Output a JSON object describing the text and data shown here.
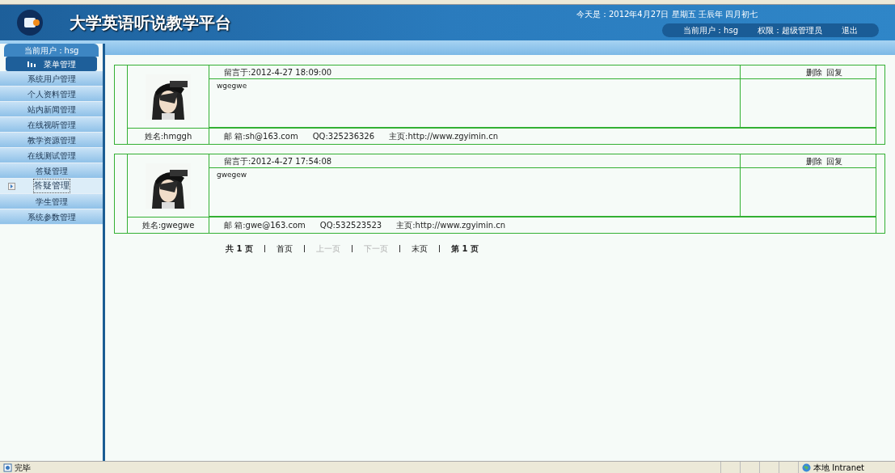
{
  "header": {
    "title": "大学英语听说教学平台",
    "date": "今天是：2012年4月27日 星期五 壬辰年 四月初七",
    "user": "当前用户：hsg",
    "role": "权限：超级管理员",
    "logout": "退出"
  },
  "sidebar": {
    "user": "当前用户：hsg",
    "menu_title": "菜单管理",
    "items": [
      {
        "label": "系统用户管理",
        "selected": false
      },
      {
        "label": "个人资料管理",
        "selected": false
      },
      {
        "label": "站内新闻管理",
        "selected": false
      },
      {
        "label": "在线视听管理",
        "selected": false
      },
      {
        "label": "教学资源管理",
        "selected": false
      },
      {
        "label": "在线测试管理",
        "selected": false
      },
      {
        "label": "答疑管理",
        "selected": false
      },
      {
        "label": "答疑管理",
        "selected": true
      },
      {
        "label": "学生管理",
        "selected": false
      },
      {
        "label": "系统参数管理",
        "selected": false
      }
    ]
  },
  "messages": [
    {
      "time": "留言于:2012-4-27 18:09:00",
      "body": "wgegwe",
      "actions": [
        "删除",
        "回复"
      ],
      "name": "姓名:hmggh",
      "email": "邮 箱:sh@163.com",
      "qq": "QQ:325236326",
      "homepage": "主页:http://www.zgyimin.cn"
    },
    {
      "time": "留言于:2012-4-27 17:54:08",
      "body": "gwegew",
      "actions": [
        "删除",
        "回复"
      ],
      "name": "姓名:gwegwe",
      "email": "邮 箱:gwe@163.com",
      "qq": "QQ:532523523",
      "homepage": "主页:http://www.zgyimin.cn"
    }
  ],
  "pagination": [
    {
      "label": "共 1 页",
      "kind": "info"
    },
    {
      "label": "首页",
      "kind": "link",
      "disabled": false
    },
    {
      "label": "上一页",
      "kind": "link",
      "disabled": true
    },
    {
      "label": "下一页",
      "kind": "link",
      "disabled": true
    },
    {
      "label": "末页",
      "kind": "link",
      "disabled": false
    },
    {
      "label": "第 1 页",
      "kind": "info"
    }
  ],
  "status_bar": {
    "status": "完毕",
    "zone": "本地 Intranet"
  }
}
